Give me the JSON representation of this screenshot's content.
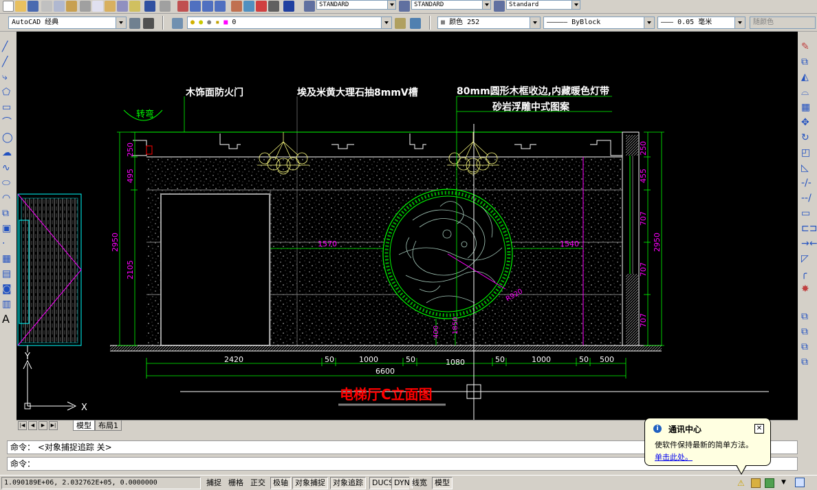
{
  "toolbar_top": {
    "text_style": "STANDARD",
    "dim_style": "STANDARD",
    "table_style": "Standard"
  },
  "toolbar_second": {
    "workspace": "AutoCAD 经典",
    "layer": "0",
    "color": "颜色 252",
    "linetype": "ByBlock",
    "lineweight": "0.05 毫米",
    "plot_style": "随颜色"
  },
  "drawing": {
    "title": "电梯厅C立面图",
    "labels": {
      "fire_door": "木饰面防火门",
      "marble": "埃及米黄大理石抽8mmV槽",
      "frame": "80mm圆形木框收边,内藏暖色灯带",
      "relief": "砂岩浮雕中式图案",
      "turn": "转弯",
      "radius": "R920"
    },
    "dimensions_bottom": [
      "2420",
      "50",
      "1000",
      "50",
      "1080",
      "50",
      "1000",
      "50",
      "500"
    ],
    "dimension_total": "6600",
    "dimensions_left": [
      "250",
      "495",
      "2105"
    ],
    "dimension_left_total": "2950",
    "dimensions_right": [
      "250",
      "455",
      "707",
      "707",
      "707"
    ],
    "dimension_right_total": "2950",
    "dim_mid_left": "1570",
    "dim_mid_right": "1540",
    "dim_vertical_a": "400",
    "dim_vertical_b": "1850",
    "ucs_x": "X",
    "ucs_y": "Y"
  },
  "tabs": {
    "model": "模型",
    "layout1": "布局1"
  },
  "command": {
    "line1": "命令： <对象捕捉追踪 关>",
    "line2": "命令："
  },
  "status": {
    "coords": "1.090189E+06, 2.032762E+05, 0.0000000",
    "buttons": [
      "捕捉",
      "栅格",
      "正交",
      "极轴",
      "对象捕捉",
      "对象追踪",
      "DUCS",
      "DYN",
      "线宽",
      "模型"
    ],
    "on_buttons": [
      "极轴",
      "对象捕捉",
      "对象追踪",
      "DUCS",
      "DYN",
      "模型"
    ]
  },
  "balloon": {
    "title": "通讯中心",
    "message": "使软件保持最新的简单方法。",
    "link": "单击此处。"
  },
  "colors": {
    "canvas_bg": "#000000",
    "cad_green": "#00ff00",
    "cad_magenta": "#ff00ff",
    "cad_white": "#ffffff",
    "cad_yellow": "#ffff80",
    "cad_red": "#ff0000",
    "cad_cyan": "#00ffff"
  }
}
